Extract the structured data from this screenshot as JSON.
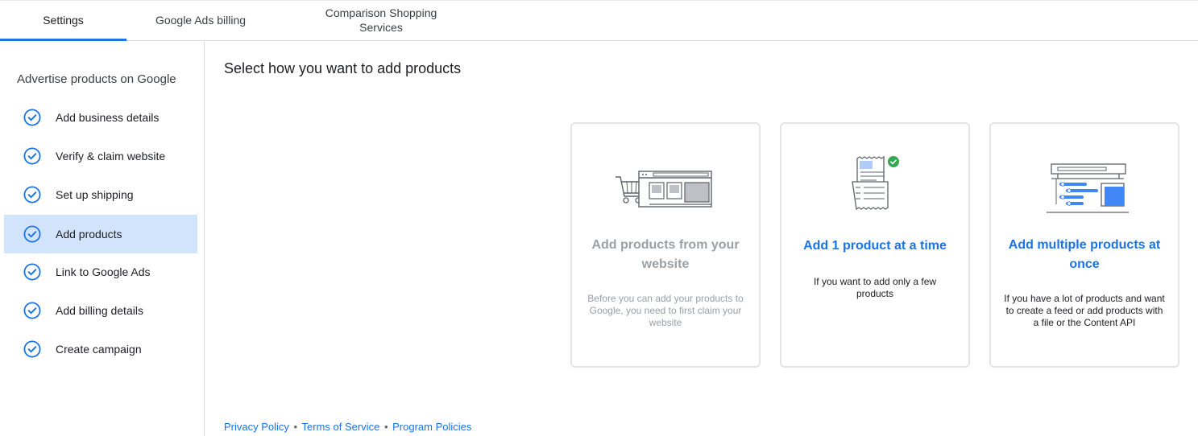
{
  "tabs": {
    "settings": "Settings",
    "billing": "Google Ads billing",
    "css_line1": "Comparison Shopping",
    "css_line2": "Services"
  },
  "sidebar": {
    "heading": "Advertise products on Google",
    "steps": [
      {
        "label": "Add business details",
        "icon": "check-circle-icon"
      },
      {
        "label": "Verify & claim website",
        "icon": "check-circle-icon"
      },
      {
        "label": "Set up shipping",
        "icon": "check-circle-icon"
      },
      {
        "label": "Add products",
        "icon": "check-circle-icon",
        "active": true
      },
      {
        "label": "Link to Google Ads",
        "icon": "check-circle-icon"
      },
      {
        "label": "Add billing details",
        "icon": "check-circle-icon"
      },
      {
        "label": "Create campaign",
        "icon": "check-circle-icon"
      }
    ]
  },
  "main": {
    "title": "Select how you want to add products",
    "cards": {
      "website": {
        "title": "Add products from your website",
        "desc": "Before you can add your products to Google, you need to first claim your website",
        "icon": "shopping-cart-website-illustration"
      },
      "single": {
        "title": "Add 1 product at a time",
        "desc": "If you want to add only a few products",
        "icon": "receipt-check-illustration"
      },
      "multi": {
        "title": "Add multiple products at once",
        "desc": "If you have a lot of products and want to create a feed or add products with a file or the Content API",
        "icon": "feed-upload-illustration"
      }
    }
  },
  "footer": {
    "privacy": "Privacy Policy",
    "terms": "Terms of Service",
    "policies": "Program Policies",
    "separator": "•"
  },
  "colors": {
    "accent": "#1a73e8",
    "active_bg": "#d2e3fc",
    "success": "#34a853",
    "muted": "#9aa0a6"
  }
}
